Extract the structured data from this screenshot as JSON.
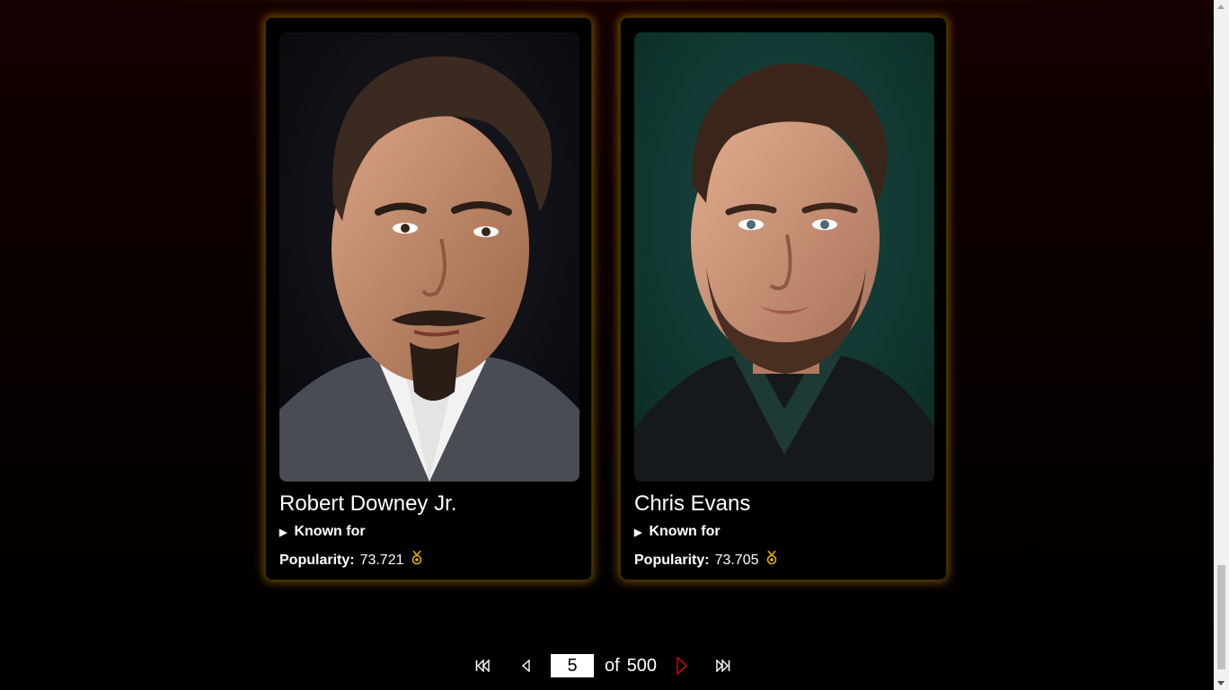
{
  "cards": [
    {
      "name": "Robert Downey Jr.",
      "known_for_label": "Known for",
      "popularity_label": "Popularity:",
      "popularity_value": "73.721",
      "photo_bg": "#101117",
      "medal_icon": "medal-icon"
    },
    {
      "name": "Chris Evans",
      "known_for_label": "Known for",
      "popularity_label": "Popularity:",
      "popularity_value": "73.705",
      "photo_bg": "#0f3a33",
      "medal_icon": "medal-icon"
    }
  ],
  "pagination": {
    "current_page": "5",
    "of_label": "of",
    "total_pages": "500",
    "next_color": "#cc0000"
  },
  "colors": {
    "card_glow": "#c98c00",
    "medal": "#e0b000"
  }
}
